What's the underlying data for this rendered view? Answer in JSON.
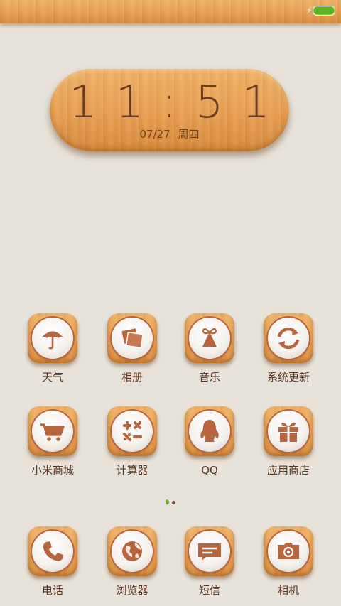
{
  "status": {
    "charging_icon": "bolt-icon",
    "battery_icon": "battery-icon",
    "battery_color": "#5ab522"
  },
  "clock": {
    "time": "11:51",
    "date": "07/27",
    "weekday": "周四"
  },
  "colors": {
    "accent": "#b8643c",
    "label": "#5a3420",
    "background": "#e8e3da"
  },
  "apps_row1": [
    {
      "label": "天气",
      "icon": "umbrella-icon"
    },
    {
      "label": "相册",
      "icon": "photos-icon"
    },
    {
      "label": "音乐",
      "icon": "music-bell-icon"
    },
    {
      "label": "系统更新",
      "icon": "refresh-icon"
    }
  ],
  "apps_row2": [
    {
      "label": "小米商城",
      "icon": "cart-icon"
    },
    {
      "label": "计算器",
      "icon": "calculator-icon"
    },
    {
      "label": "QQ",
      "icon": "penguin-icon"
    },
    {
      "label": "应用商店",
      "icon": "gift-icon"
    }
  ],
  "dock": [
    {
      "label": "电话",
      "icon": "phone-icon"
    },
    {
      "label": "浏览器",
      "icon": "globe-icon"
    },
    {
      "label": "短信",
      "icon": "message-icon"
    },
    {
      "label": "相机",
      "icon": "camera-icon"
    }
  ],
  "page_indicator": {
    "pages": 2,
    "current": 1
  }
}
